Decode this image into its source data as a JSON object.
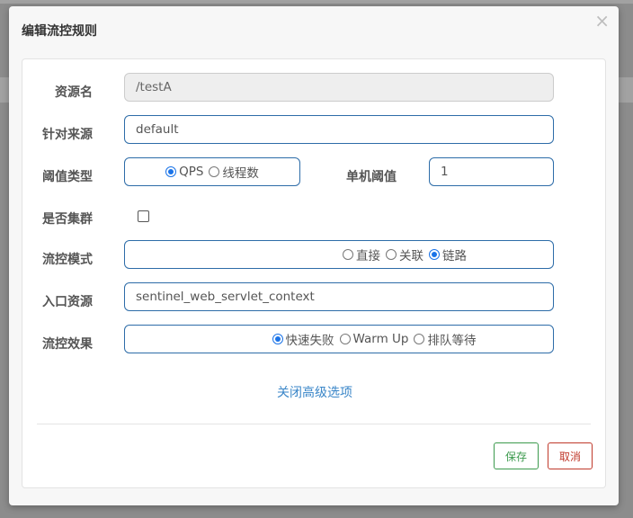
{
  "dialog": {
    "title": "编辑流控规则",
    "close_label": "×"
  },
  "form": {
    "resource_name": {
      "label": "资源名",
      "value": "/testA"
    },
    "limit_app": {
      "label": "针对来源",
      "value": "default"
    },
    "threshold_type": {
      "label": "阈值类型",
      "options": [
        {
          "label": "QPS",
          "checked": true
        },
        {
          "label": "线程数",
          "checked": false
        }
      ]
    },
    "single_threshold": {
      "label": "单机阈值",
      "value": "1"
    },
    "cluster": {
      "label": "是否集群",
      "checked": false
    },
    "strategy": {
      "label": "流控模式",
      "options": [
        {
          "label": "直接",
          "checked": false
        },
        {
          "label": "关联",
          "checked": false
        },
        {
          "label": "链路",
          "checked": true
        }
      ]
    },
    "ref_resource": {
      "label": "入口资源",
      "value": "sentinel_web_servlet_context"
    },
    "control_behavior": {
      "label": "流控效果",
      "options": [
        {
          "label": "快速失败",
          "checked": true
        },
        {
          "label": "Warm Up",
          "checked": false
        },
        {
          "label": "排队等待",
          "checked": false
        }
      ]
    },
    "advanced_toggle": "关闭高级选项"
  },
  "footer": {
    "save_label": "保存",
    "cancel_label": "取消"
  },
  "colors": {
    "accent": "#2d6ca8",
    "link": "#3a86c8",
    "save": "#3c9a4d",
    "cancel": "#c0392b"
  }
}
